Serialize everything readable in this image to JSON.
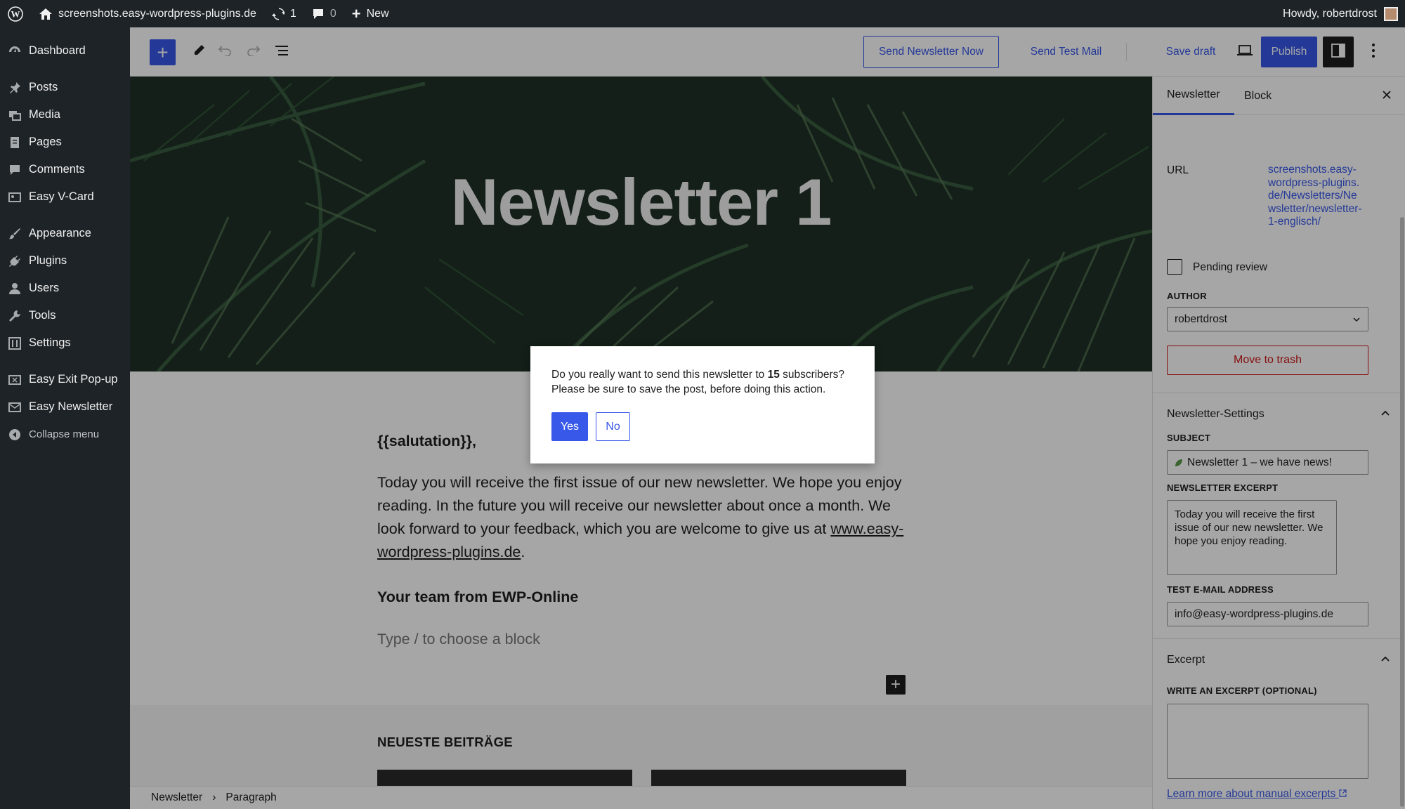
{
  "adminbar": {
    "site_name": "screenshots.easy-wordpress-plugins.de",
    "updates_count": "1",
    "comments_count": "0",
    "new_label": "New",
    "greeting": "Howdy, robertdrost"
  },
  "menu": {
    "dashboard": "Dashboard",
    "posts": "Posts",
    "media": "Media",
    "pages": "Pages",
    "comments": "Comments",
    "vcard": "Easy V-Card",
    "appearance": "Appearance",
    "plugins": "Plugins",
    "users": "Users",
    "tools": "Tools",
    "settings": "Settings",
    "exit_popup": "Easy Exit Pop-up",
    "newsletter": "Easy Newsletter",
    "collapse": "Collapse menu"
  },
  "toolbar": {
    "send_now": "Send Newsletter Now",
    "send_test": "Send Test Mail",
    "save_draft": "Save draft",
    "publish": "Publish"
  },
  "content": {
    "cover_title": "Newsletter 1",
    "salutation": "{{salutation}},",
    "body_text": "Today you will receive the first issue of our new newsletter. We hope you enjoy reading. In the future you will receive our newsletter about once a month. We look forward to your feedback, which you are welcome to give us at",
    "link_text": "www.easy-wordpress-plugins.de",
    "link_after": ".",
    "signature": "Your team from EWP-Online",
    "placeholder": "Type / to choose a block",
    "latest_title": "NEUESTE BEITRÄGE"
  },
  "breadcrumb": {
    "first": "Newsletter",
    "separator": "›",
    "second": "Paragraph"
  },
  "sidebar": {
    "tab_newsletter": "Newsletter",
    "tab_block": "Block",
    "url_label": "URL",
    "url_value": "screenshots.easy-wordpress-plugins.de/Newsletters/Newsletter/newsletter-1-englisch/",
    "pending_review": "Pending review",
    "author_label": "AUTHOR",
    "author_value": "robertdrost",
    "trash": "Move to trash",
    "newsletter_settings": "Newsletter-Settings",
    "subject_label": "SUBJECT",
    "subject_value": "Newsletter 1 – we have news!",
    "excerpt_label": "NEWSLETTER EXCERPT",
    "excerpt_value": "Today you will receive the first issue of our new newsletter. We hope you enjoy reading.",
    "test_email_label": "TEST E-MAIL ADDRESS",
    "test_email_value": "info@easy-wordpress-plugins.de",
    "excerpt_panel": "Excerpt",
    "write_excerpt_label": "WRITE AN EXCERPT (OPTIONAL)",
    "learn_more": "Learn more about manual excerpts"
  },
  "modal": {
    "text_before": "Do you really want to send this newsletter to",
    "count": "15",
    "text_after": "subscribers?",
    "line2": "Please be sure to save the post, before doing this action.",
    "yes": "Yes",
    "no": "No"
  },
  "colors": {
    "accent": "#3858e9",
    "admin_bg": "#1d2327",
    "danger": "#cc1818"
  }
}
